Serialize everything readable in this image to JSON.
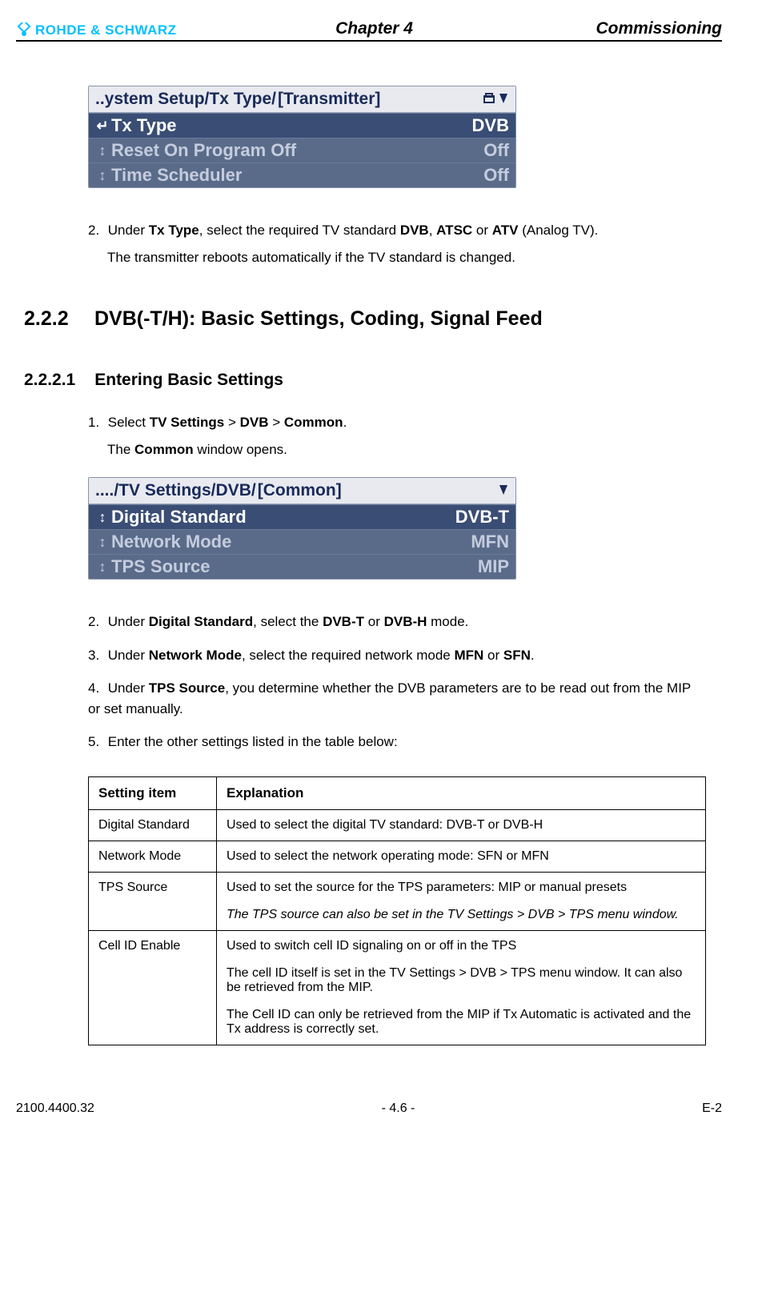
{
  "header": {
    "logo_text": "ROHDE & SCHWARZ",
    "center": "Chapter 4",
    "right": "Commissioning"
  },
  "lcd1": {
    "title_prefix": "..ystem Setup/Tx Type/",
    "title_bracket_open": "[",
    "title_item": "Transmitter",
    "title_bracket_close": "]",
    "rows": [
      {
        "arrow": "↵",
        "label": "Tx Type",
        "value": "DVB",
        "selected": true
      },
      {
        "arrow": "↕",
        "label": "Reset On Program Off",
        "value": "Off",
        "selected": false
      },
      {
        "arrow": "↕",
        "label": "Time Scheduler",
        "value": "Off",
        "selected": false
      }
    ]
  },
  "step2": {
    "num": "2.",
    "text_before": "Under ",
    "b1": "Tx Type",
    "text_mid1": ", select the required TV standard ",
    "b2": "DVB",
    "text_sep1": ", ",
    "b3": "ATSC",
    "text_sep2": " or ",
    "b4": "ATV",
    "text_after": " (Analog TV).",
    "sub": "The transmitter reboots automatically if the TV standard is changed."
  },
  "h2": {
    "num": "2.2.2",
    "title": "DVB(-T/H): Basic Settings, Coding, Signal Feed"
  },
  "h3": {
    "num": "2.2.2.1",
    "title": "Entering Basic Settings"
  },
  "stepA": {
    "num": "1.",
    "t1": "Select ",
    "b1": "TV Settings",
    "t2": " > ",
    "b2": "DVB",
    "t3": " > ",
    "b3": "Common",
    "t4": ".",
    "sub1": "The ",
    "sub_b": "Common",
    "sub2": " window opens."
  },
  "lcd2": {
    "title_prefix": "..../TV Settings/DVB/",
    "title_item": "Common",
    "rows": [
      {
        "arrow": "↕",
        "label": "Digital Standard",
        "value": "DVB-T",
        "selected": true
      },
      {
        "arrow": "↕",
        "label": "Network Mode",
        "value": "MFN",
        "selected": false
      },
      {
        "arrow": "↕",
        "label": "TPS Source",
        "value": "MIP",
        "selected": false
      }
    ]
  },
  "stepB": {
    "num": "2.",
    "t1": "Under ",
    "b1": "Digital Standard",
    "t2": ", select the ",
    "b2": "DVB-T",
    "t3": " or ",
    "b3": "DVB-H",
    "t4": " mode."
  },
  "stepC": {
    "num": "3.",
    "t1": "Under ",
    "b1": "Network Mode",
    "t2": ", select the required network mode ",
    "b2": "MFN",
    "t3": " or ",
    "b3": "SFN",
    "t4": "."
  },
  "stepD": {
    "num": "4.",
    "t1": "Under ",
    "b1": "TPS Source",
    "t2": ", you determine whether the DVB parameters are to be read out from the MIP or set manually."
  },
  "stepE": {
    "num": "5.",
    "t1": "Enter the other settings listed in the table below:"
  },
  "table": {
    "h1": "Setting item",
    "h2": "Explanation",
    "rows": [
      {
        "c1": "Digital Standard",
        "c2a": "Used to select the digital TV standard: DVB-T or DVB-H"
      },
      {
        "c1": "Network Mode",
        "c2a": "Used to select the network operating mode: SFN or MFN"
      },
      {
        "c1": "TPS Source",
        "c2a": "Used to set the source for the TPS parameters: MIP or manual presets",
        "c2b_italic": "The TPS source can also be set in the TV Settings > DVB > TPS menu window."
      },
      {
        "c1": "Cell ID Enable",
        "c2a": "Used to switch cell ID signaling on or off in the TPS",
        "c2b": "The cell ID itself is set in the TV Settings > DVB > TPS menu window. It can also be retrieved from the MIP.",
        "c2c": "The Cell ID can only be retrieved from the MIP if Tx Automatic is activated and the Tx address is correctly set."
      }
    ]
  },
  "footer": {
    "left": "2100.4400.32",
    "center": "- 4.6 -",
    "right": "E-2"
  }
}
